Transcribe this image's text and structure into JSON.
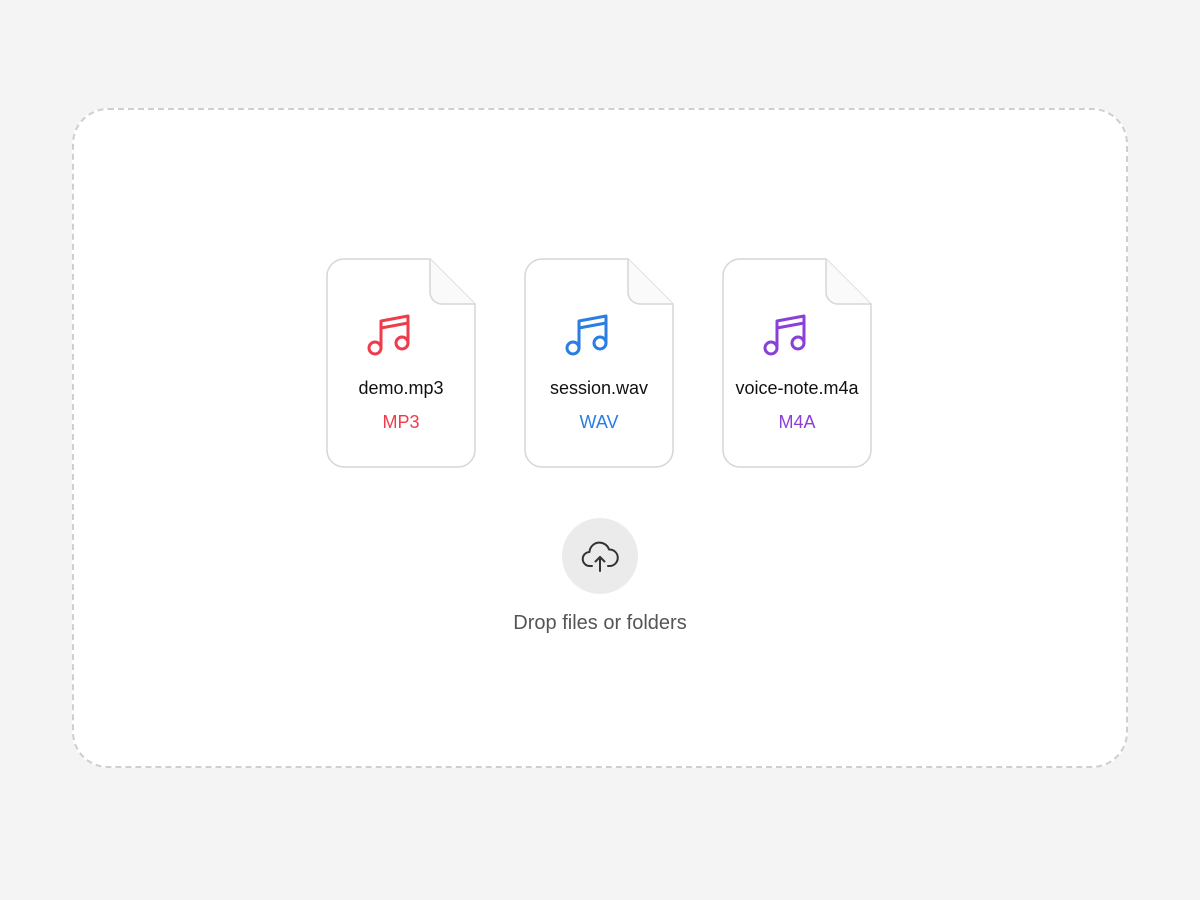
{
  "dropzone": {
    "hint": "Drop files or folders",
    "upload_icon": "cloud-upload-icon"
  },
  "files": [
    {
      "name": "demo.mp3",
      "ext": "MP3",
      "color": "#ef3b4c",
      "icon": "music-note-icon"
    },
    {
      "name": "session.wav",
      "ext": "WAV",
      "color": "#2a7de1",
      "icon": "music-note-icon"
    },
    {
      "name": "voice-note.m4a",
      "ext": "M4A",
      "color": "#8a3fd9",
      "icon": "music-note-icon"
    }
  ]
}
